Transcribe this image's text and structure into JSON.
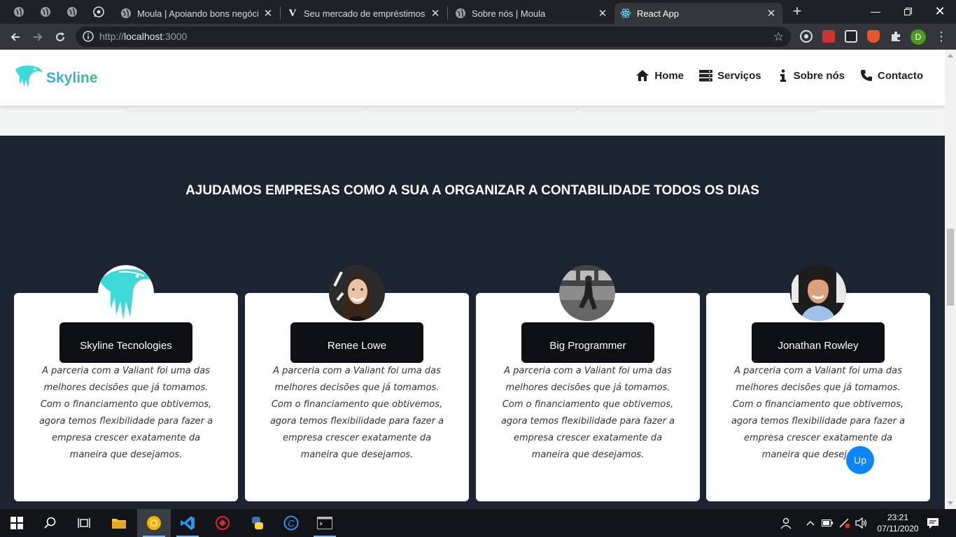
{
  "browser": {
    "tabs": [
      {
        "title": "Moula | Apoiando bons negócios",
        "fav": "globe-icon"
      },
      {
        "title": "Seu mercado de empréstimos pa",
        "fav": "v-logo-icon"
      },
      {
        "title": "Sobre nós | Moula",
        "fav": "globe-icon"
      },
      {
        "title": "React App",
        "fav": "react-icon",
        "active": true
      }
    ],
    "url_prefix": "http://",
    "url_host": "localhost",
    "url_port": ":3000",
    "profile_initial": "D"
  },
  "nav": {
    "brand": "Skyline",
    "links": [
      {
        "label": "Home",
        "icon": "home-icon"
      },
      {
        "label": "Serviços",
        "icon": "server-icon"
      },
      {
        "label": "Sobre nós",
        "icon": "info-icon"
      },
      {
        "label": "Contacto",
        "icon": "phone-icon"
      }
    ]
  },
  "section": {
    "headline": "AJUDAMOS EMPRESAS COMO A SUA A ORGANIZAR A CONTABILIDADE TODOS OS DIAS",
    "testimonials": [
      {
        "name": "Skyline Tecnologies",
        "quote": "A parceria com a Valiant foi uma das melhores decisões que já tomamos. Com o financiamento que obtivemos, agora temos flexibilidade para fazer a empresa crescer exatamente da maneira que desejamos."
      },
      {
        "name": "Renee Lowe",
        "quote": "A parceria com a Valiant foi uma das melhores decisões que já tomamos. Com o financiamento que obtivemos, agora temos flexibilidade para fazer a empresa crescer exatamente da maneira que desejamos."
      },
      {
        "name": "Big Programmer",
        "quote": "A parceria com a Valiant foi uma das melhores decisões que já tomamos. Com o financiamento que obtivemos, agora temos flexibilidade para fazer a empresa crescer exatamente da maneira que desejamos."
      },
      {
        "name": "Jonathan Rowley",
        "quote": "A parceria com a Valiant foi uma das melhores decisões que já tomamos. Com o financiamento que obtivemos, agora temos flexibilidade para fazer a empresa crescer exatamente da maneira que desejamos."
      }
    ],
    "up_button": "Up"
  },
  "taskbar": {
    "time": "23:21",
    "date": "07/11/2020"
  },
  "colors": {
    "dark_section": "#1c2331",
    "card": "#ffffff",
    "name_box": "#0e0f12",
    "up_button": "#0a84ff",
    "brand_gradient": [
      "#3aa7e8",
      "#3fbf7a"
    ],
    "logo_bird": "#3fd8d8"
  }
}
